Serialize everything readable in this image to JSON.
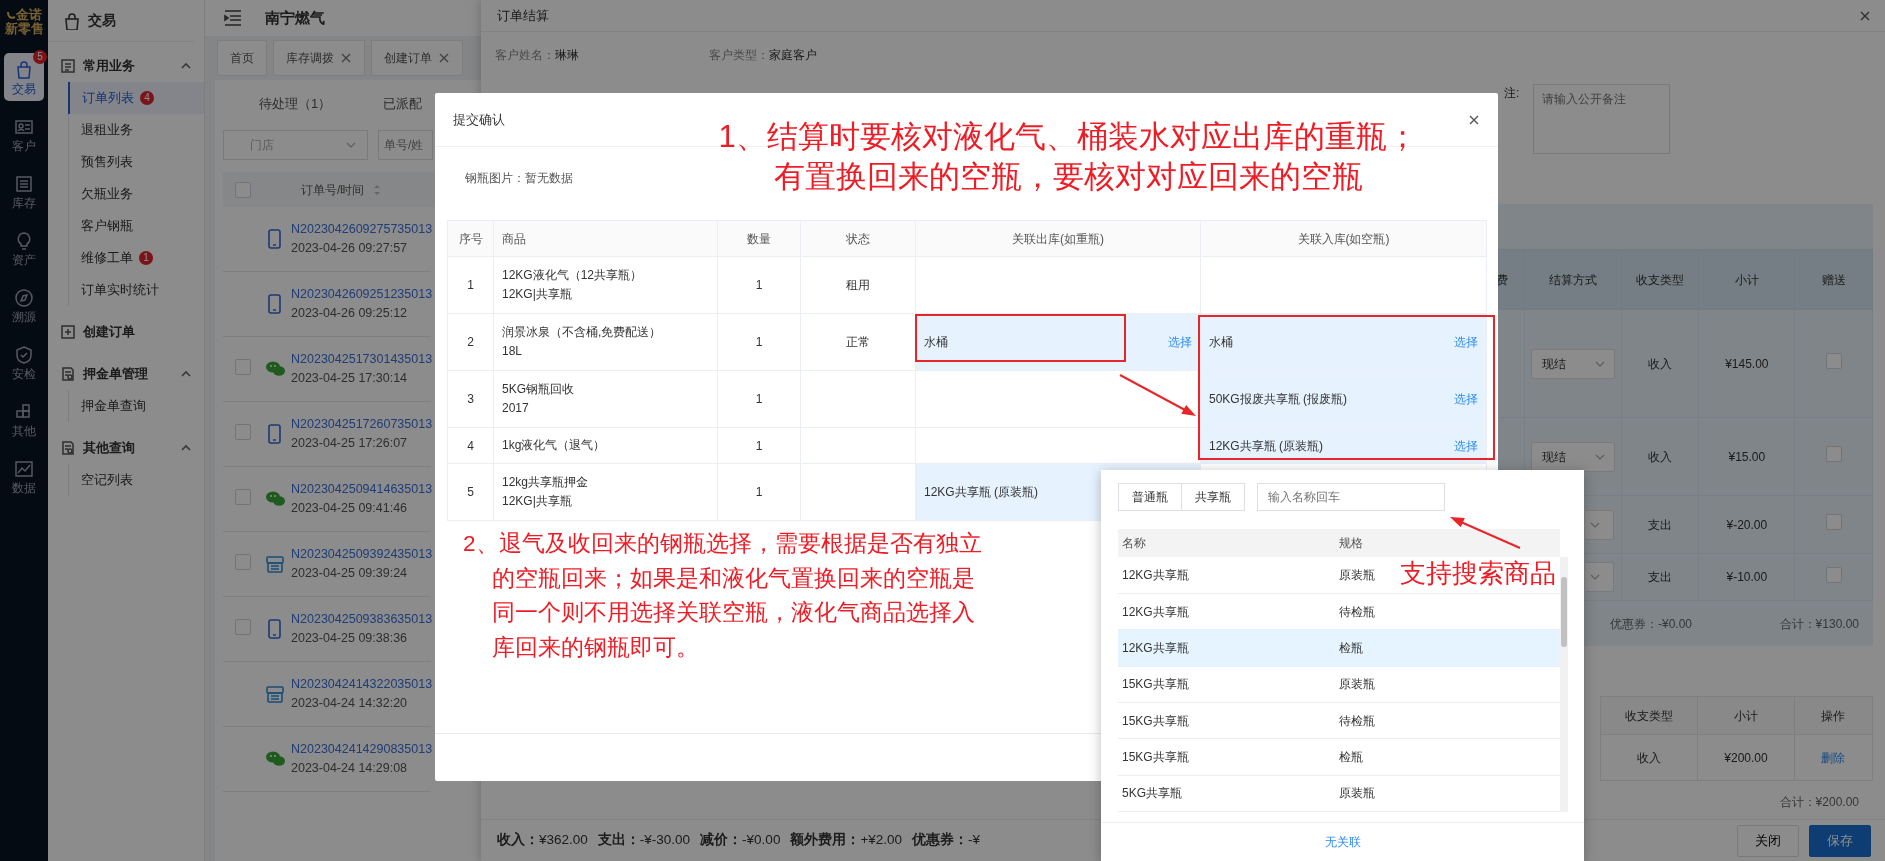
{
  "nav_rail": {
    "logo": "金诺",
    "logo_subtitle": "新零售",
    "items": [
      {
        "label": "交易",
        "selected": true,
        "badge": "5"
      },
      {
        "label": "客户",
        "selected": false
      },
      {
        "label": "库存",
        "selected": false
      },
      {
        "label": "资产",
        "selected": false
      },
      {
        "label": "溯源",
        "selected": false
      },
      {
        "label": "安检",
        "selected": false
      },
      {
        "label": "其他",
        "selected": false
      },
      {
        "label": "数据",
        "selected": false
      }
    ]
  },
  "sidebar": {
    "title": "交易",
    "groups": [
      {
        "label": "常用业务",
        "expanded": true,
        "children": [
          {
            "label": "订单列表",
            "selected": true,
            "badge": "4"
          },
          {
            "label": "退租业务",
            "selected": false
          },
          {
            "label": "预售列表",
            "selected": false
          },
          {
            "label": "欠瓶业务",
            "selected": false
          },
          {
            "label": "客户钢瓶",
            "selected": false
          },
          {
            "label": "维修工单",
            "selected": false,
            "badge": "1"
          },
          {
            "label": "订单实时统计",
            "selected": false
          }
        ]
      },
      {
        "label": "创建订单"
      },
      {
        "label": "押金单管理",
        "expanded": true,
        "children": [
          {
            "label": "押金单查询",
            "selected": false
          }
        ]
      },
      {
        "label": "其他查询",
        "expanded": true,
        "children": [
          {
            "label": "空记列表",
            "selected": false
          }
        ]
      }
    ]
  },
  "header": {
    "title": "南宁燃气"
  },
  "page_tabs": [
    {
      "label": "首页",
      "closable": false,
      "selected": false
    },
    {
      "label": "库存调拨",
      "closable": true,
      "selected": false
    },
    {
      "label": "创建订单",
      "closable": true,
      "selected": false
    }
  ],
  "order_tabs": [
    {
      "label": "待处理（1）",
      "selected": false
    },
    {
      "label": "已派配",
      "selected": false
    }
  ],
  "filters": {
    "store": {
      "placeholder": "门店"
    },
    "search": {
      "placeholder": "单号/姓"
    }
  },
  "orders": {
    "column": "订单号/时间",
    "select_all_checked": false,
    "rows": [
      {
        "number": "N2023042609275735013",
        "time": "2023-04-26 09:27:57",
        "kind": "phone",
        "selectable": false
      },
      {
        "number": "N2023042609251235013",
        "time": "2023-04-26 09:25:12",
        "kind": "phone",
        "selectable": false
      },
      {
        "number": "N2023042517301435013",
        "time": "2023-04-25 17:30:14",
        "kind": "wechat",
        "selectable": true,
        "checked": false
      },
      {
        "number": "N2023042517260735013",
        "time": "2023-04-25 17:26:07",
        "kind": "phone",
        "selectable": true,
        "checked": false
      },
      {
        "number": "N2023042509414635013",
        "time": "2023-04-25 09:41:46",
        "kind": "wechat",
        "selectable": true,
        "checked": false
      },
      {
        "number": "N2023042509392435013",
        "time": "2023-04-25 09:39:24",
        "kind": "pos",
        "selectable": true,
        "checked": false
      },
      {
        "number": "N2023042509383635013",
        "time": "2023-04-25 09:38:36",
        "kind": "phone",
        "selectable": true,
        "checked": false
      },
      {
        "number": "N2023042414322035013",
        "time": "2023-04-24 14:32:20",
        "kind": "pos",
        "selectable": false
      },
      {
        "number": "N2023042414290835013",
        "time": "2023-04-24 14:29:08",
        "kind": "wechat",
        "selectable": false
      }
    ]
  },
  "drawer": {
    "title": "订单结算",
    "customer_name_label": "客户姓名：",
    "customer_name": "琳琳",
    "customer_type_label": "客户类型：",
    "customer_type": "家庭客户",
    "remark_label": "注:",
    "remark": {
      "placeholder": "请输入公开备注"
    },
    "goods_table": {
      "columns": [
        "费",
        "结算方式",
        "收支类型",
        "小计",
        "赠送"
      ],
      "rows": [
        {
          "settlement": "现结",
          "type": "收入",
          "subtotal": "¥145.00",
          "gift": false
        },
        {
          "settlement": "现结",
          "type": "收入",
          "subtotal": "¥15.00",
          "gift": false
        },
        {
          "type": "支出",
          "subtotal": "¥-20.00",
          "gift": false
        },
        {
          "type": "支出",
          "subtotal": "¥-10.00",
          "gift": false
        }
      ],
      "coupon": "优惠券：-¥0.00",
      "total": "合计：¥130.00"
    },
    "fee_table": {
      "columns": [
        "收支类型",
        "小计",
        "操作"
      ],
      "rows": [
        {
          "type": "收入",
          "subtotal": "¥200.00",
          "action": "删除"
        }
      ],
      "total": "合计：¥200.00"
    },
    "summary": [
      {
        "label": "收入：",
        "value": "¥362.00"
      },
      {
        "label": "支出：",
        "value": "-¥-30.00"
      },
      {
        "label": "减价：",
        "value": "-¥0.00"
      },
      {
        "label": "额外费用：",
        "value": "+¥2.00"
      },
      {
        "label": "优惠券：",
        "value": "-¥"
      }
    ],
    "buttons": [
      {
        "label": "关闭",
        "kind": "default"
      },
      {
        "label": "保存",
        "kind": "primary"
      }
    ]
  },
  "modal": {
    "title": "提交确认",
    "photo_label": "钢瓶图片：",
    "photo_value": "暂无数据",
    "columns": [
      "序号",
      "商品",
      "数量",
      "状态",
      "关联出库(如重瓶)",
      "关联入库(如空瓶)"
    ],
    "rows": [
      {
        "index": "1",
        "product": [
          "12KG液化气（12共享瓶）",
          "12KG|共享瓶"
        ],
        "qty": "1",
        "status": "租用"
      },
      {
        "index": "2",
        "product": [
          "润景冰泉（不含桶,免费配送）",
          "18L"
        ],
        "qty": "1",
        "status": "正常",
        "outbound": {
          "text": "水桶",
          "action": "选择"
        },
        "inbound": {
          "text": "水桶",
          "action": "选择"
        }
      },
      {
        "index": "3",
        "product": [
          "5KG钢瓶回收",
          "2017"
        ],
        "qty": "1",
        "inbound": {
          "text": "50KG报废共享瓶 (报废瓶)",
          "action": "选择"
        }
      },
      {
        "index": "4",
        "product": [
          "1kg液化气（退气）"
        ],
        "qty": "1",
        "inbound": {
          "text": "12KG共享瓶 (原装瓶)",
          "action": "选择"
        }
      },
      {
        "index": "5",
        "product": [
          "12kg共享瓶押金",
          "12KG|共享瓶"
        ],
        "qty": "1",
        "outbound": {
          "text": "12KG共享瓶 (原装瓶)"
        }
      }
    ]
  },
  "picker": {
    "tabs": [
      {
        "label": "普通瓶",
        "selected": false
      },
      {
        "label": "共享瓶",
        "selected": false
      }
    ],
    "search": {
      "placeholder": "输入名称回车"
    },
    "columns": [
      "名称",
      "规格"
    ],
    "rows": [
      {
        "name": "12KG共享瓶",
        "spec": "原装瓶",
        "selected": false
      },
      {
        "name": "12KG共享瓶",
        "spec": "待检瓶",
        "selected": false
      },
      {
        "name": "12KG共享瓶",
        "spec": "检瓶",
        "selected": true
      },
      {
        "name": "15KG共享瓶",
        "spec": "原装瓶",
        "selected": false
      },
      {
        "name": "15KG共享瓶",
        "spec": "待检瓶",
        "selected": false
      },
      {
        "name": "15KG共享瓶",
        "spec": "检瓶",
        "selected": false
      },
      {
        "name": "5KG共享瓶",
        "spec": "原装瓶",
        "selected": false
      }
    ],
    "footer_link": "无关联"
  },
  "annotations": [
    {
      "text": "1、结算时要核对液化气、桶装水对应出库的重瓶；有置换回来的空瓶，要核对对应回来的空瓶"
    },
    {
      "text": "2、退气及收回来的钢瓶选择，需要根据是否有独立的空瓶回来；如果是和液化气置换回来的空瓶是同一个则不用选择关联空瓶，液化气商品选择入库回来的钢瓶即可。"
    },
    {
      "text": "支持搜索商品"
    }
  ]
}
